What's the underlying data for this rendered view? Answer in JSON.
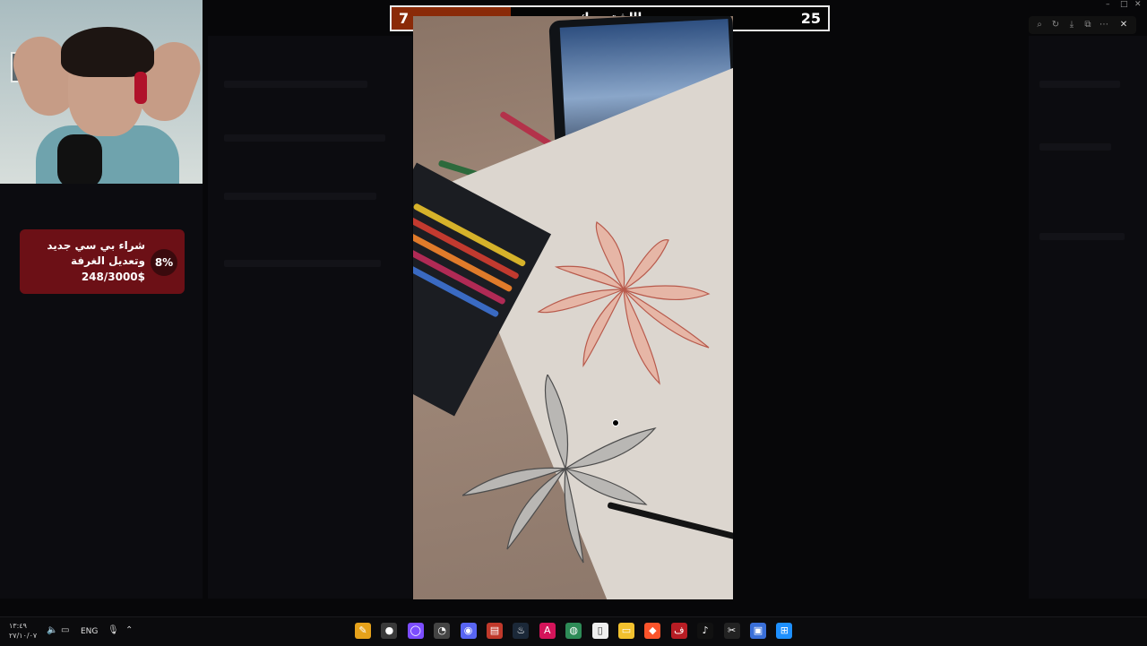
{
  "score": {
    "left_value": "7",
    "right_value": "25",
    "title": "اااشترررك"
  },
  "goal": {
    "title": "شراء بي سي جديد وتعديل الغرفة",
    "amount": "248/3000$",
    "percent": "8%",
    "progress": 0.08
  },
  "window_controls": [
    "–",
    "□",
    "✕"
  ],
  "viewer_tools": [
    "zoom-icon",
    "rotate-icon",
    "download-icon",
    "open-icon",
    "more-icon",
    "close-icon"
  ],
  "taskbar": {
    "time": "١٣:٤٩",
    "date": "٢٧/١٠/٠٧",
    "language": "ENG",
    "apps": [
      {
        "name": "pencil-app-icon",
        "color": "#e6a21b",
        "glyph": "✎"
      },
      {
        "name": "obs-icon",
        "color": "#3a3a3a",
        "glyph": "●"
      },
      {
        "name": "circle-app-icon",
        "color": "#7c4dff",
        "glyph": "◯"
      },
      {
        "name": "speedtest-icon",
        "color": "#444",
        "glyph": "◔"
      },
      {
        "name": "discord-icon",
        "color": "#5865f2",
        "glyph": "◉"
      },
      {
        "name": "stream-app-icon",
        "color": "#c0392b",
        "glyph": "▤"
      },
      {
        "name": "steam-icon",
        "color": "#1b2838",
        "glyph": "♨"
      },
      {
        "name": "adobe-icon",
        "color": "#d4145a",
        "glyph": "A"
      },
      {
        "name": "chrome-icon",
        "color": "#2e8b57",
        "glyph": "◍"
      },
      {
        "name": "file-icon",
        "color": "#eeeeee",
        "glyph": "▯"
      },
      {
        "name": "folder-icon",
        "color": "#f2c12e",
        "glyph": "▭"
      },
      {
        "name": "brave-icon",
        "color": "#fb542b",
        "glyph": "◆"
      },
      {
        "name": "red-app-icon",
        "color": "#b81d24",
        "glyph": "ف"
      },
      {
        "name": "tiktok-icon",
        "color": "#111111",
        "glyph": "♪"
      },
      {
        "name": "capcut-icon",
        "color": "#222222",
        "glyph": "✂"
      },
      {
        "name": "store-icon",
        "color": "#3a6fd8",
        "glyph": "▣"
      },
      {
        "name": "windows-icon",
        "color": "#1e90ff",
        "glyph": "⊞"
      }
    ]
  }
}
